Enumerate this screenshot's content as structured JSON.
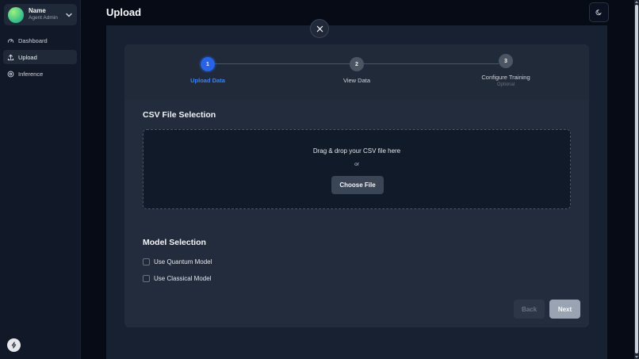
{
  "profile": {
    "name": "Name",
    "role": "Agent Admin"
  },
  "nav": [
    {
      "label": "Dashboard",
      "icon": "gauge-icon",
      "active": false
    },
    {
      "label": "Upload",
      "icon": "upload-icon",
      "active": true
    },
    {
      "label": "Inference",
      "icon": "inference-icon",
      "active": false
    }
  ],
  "header": {
    "title": "Upload"
  },
  "stepper": {
    "steps": [
      {
        "number": "1",
        "label": "Upload Data",
        "sublabel": "",
        "active": true
      },
      {
        "number": "2",
        "label": "View Data",
        "sublabel": "",
        "active": false
      },
      {
        "number": "3",
        "label": "Configure Training",
        "sublabel": "Optional",
        "active": false
      }
    ]
  },
  "csv": {
    "title": "CSV File Selection",
    "drop_text": "Drag & drop your CSV file here",
    "or_text": "or",
    "choose_label": "Choose File"
  },
  "model": {
    "title": "Model Selection",
    "options": [
      {
        "label": "Use Quantum Model",
        "checked": false
      },
      {
        "label": "Use Classical Model",
        "checked": false
      }
    ]
  },
  "actions": {
    "back_label": "Back",
    "next_label": "Next"
  },
  "colors": {
    "accent": "#2563eb",
    "background": "#070b16",
    "card": "#222c3c"
  }
}
